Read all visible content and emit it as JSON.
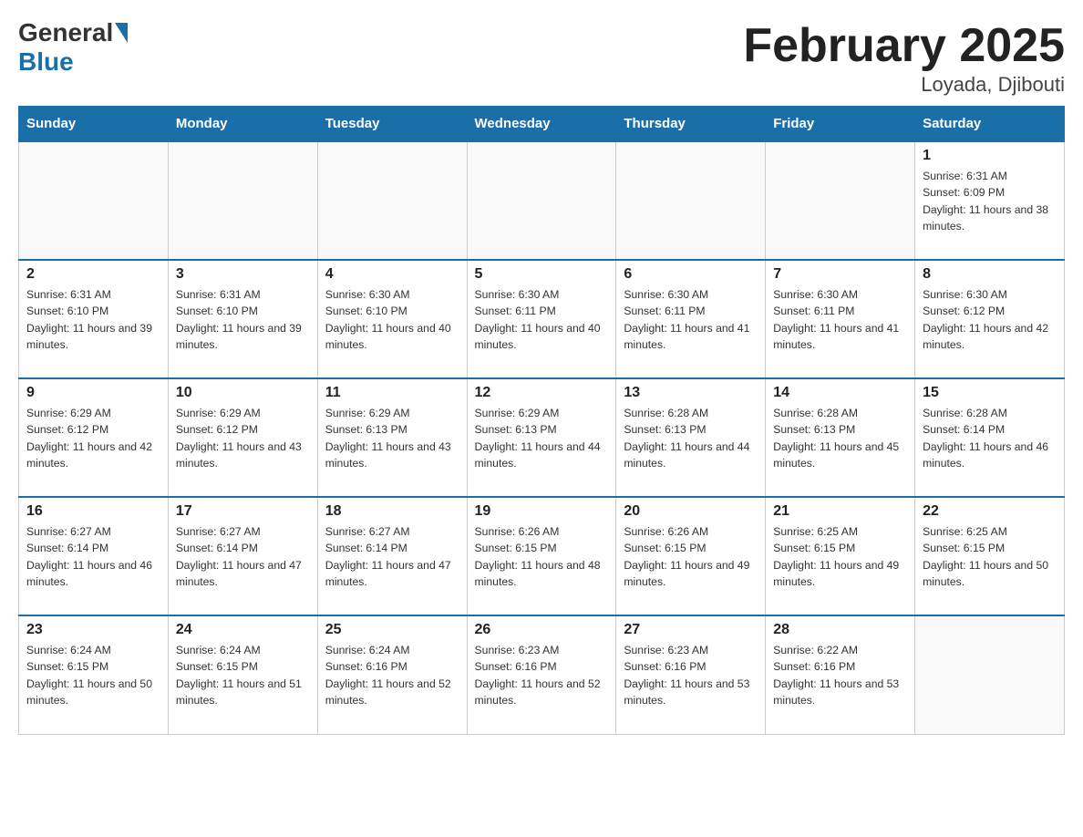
{
  "header": {
    "logo_general": "General",
    "logo_blue": "Blue",
    "month_title": "February 2025",
    "location": "Loyada, Djibouti"
  },
  "days_of_week": [
    "Sunday",
    "Monday",
    "Tuesday",
    "Wednesday",
    "Thursday",
    "Friday",
    "Saturday"
  ],
  "weeks": [
    [
      {
        "day": "",
        "info": ""
      },
      {
        "day": "",
        "info": ""
      },
      {
        "day": "",
        "info": ""
      },
      {
        "day": "",
        "info": ""
      },
      {
        "day": "",
        "info": ""
      },
      {
        "day": "",
        "info": ""
      },
      {
        "day": "1",
        "info": "Sunrise: 6:31 AM\nSunset: 6:09 PM\nDaylight: 11 hours and 38 minutes."
      }
    ],
    [
      {
        "day": "2",
        "info": "Sunrise: 6:31 AM\nSunset: 6:10 PM\nDaylight: 11 hours and 39 minutes."
      },
      {
        "day": "3",
        "info": "Sunrise: 6:31 AM\nSunset: 6:10 PM\nDaylight: 11 hours and 39 minutes."
      },
      {
        "day": "4",
        "info": "Sunrise: 6:30 AM\nSunset: 6:10 PM\nDaylight: 11 hours and 40 minutes."
      },
      {
        "day": "5",
        "info": "Sunrise: 6:30 AM\nSunset: 6:11 PM\nDaylight: 11 hours and 40 minutes."
      },
      {
        "day": "6",
        "info": "Sunrise: 6:30 AM\nSunset: 6:11 PM\nDaylight: 11 hours and 41 minutes."
      },
      {
        "day": "7",
        "info": "Sunrise: 6:30 AM\nSunset: 6:11 PM\nDaylight: 11 hours and 41 minutes."
      },
      {
        "day": "8",
        "info": "Sunrise: 6:30 AM\nSunset: 6:12 PM\nDaylight: 11 hours and 42 minutes."
      }
    ],
    [
      {
        "day": "9",
        "info": "Sunrise: 6:29 AM\nSunset: 6:12 PM\nDaylight: 11 hours and 42 minutes."
      },
      {
        "day": "10",
        "info": "Sunrise: 6:29 AM\nSunset: 6:12 PM\nDaylight: 11 hours and 43 minutes."
      },
      {
        "day": "11",
        "info": "Sunrise: 6:29 AM\nSunset: 6:13 PM\nDaylight: 11 hours and 43 minutes."
      },
      {
        "day": "12",
        "info": "Sunrise: 6:29 AM\nSunset: 6:13 PM\nDaylight: 11 hours and 44 minutes."
      },
      {
        "day": "13",
        "info": "Sunrise: 6:28 AM\nSunset: 6:13 PM\nDaylight: 11 hours and 44 minutes."
      },
      {
        "day": "14",
        "info": "Sunrise: 6:28 AM\nSunset: 6:13 PM\nDaylight: 11 hours and 45 minutes."
      },
      {
        "day": "15",
        "info": "Sunrise: 6:28 AM\nSunset: 6:14 PM\nDaylight: 11 hours and 46 minutes."
      }
    ],
    [
      {
        "day": "16",
        "info": "Sunrise: 6:27 AM\nSunset: 6:14 PM\nDaylight: 11 hours and 46 minutes."
      },
      {
        "day": "17",
        "info": "Sunrise: 6:27 AM\nSunset: 6:14 PM\nDaylight: 11 hours and 47 minutes."
      },
      {
        "day": "18",
        "info": "Sunrise: 6:27 AM\nSunset: 6:14 PM\nDaylight: 11 hours and 47 minutes."
      },
      {
        "day": "19",
        "info": "Sunrise: 6:26 AM\nSunset: 6:15 PM\nDaylight: 11 hours and 48 minutes."
      },
      {
        "day": "20",
        "info": "Sunrise: 6:26 AM\nSunset: 6:15 PM\nDaylight: 11 hours and 49 minutes."
      },
      {
        "day": "21",
        "info": "Sunrise: 6:25 AM\nSunset: 6:15 PM\nDaylight: 11 hours and 49 minutes."
      },
      {
        "day": "22",
        "info": "Sunrise: 6:25 AM\nSunset: 6:15 PM\nDaylight: 11 hours and 50 minutes."
      }
    ],
    [
      {
        "day": "23",
        "info": "Sunrise: 6:24 AM\nSunset: 6:15 PM\nDaylight: 11 hours and 50 minutes."
      },
      {
        "day": "24",
        "info": "Sunrise: 6:24 AM\nSunset: 6:15 PM\nDaylight: 11 hours and 51 minutes."
      },
      {
        "day": "25",
        "info": "Sunrise: 6:24 AM\nSunset: 6:16 PM\nDaylight: 11 hours and 52 minutes."
      },
      {
        "day": "26",
        "info": "Sunrise: 6:23 AM\nSunset: 6:16 PM\nDaylight: 11 hours and 52 minutes."
      },
      {
        "day": "27",
        "info": "Sunrise: 6:23 AM\nSunset: 6:16 PM\nDaylight: 11 hours and 53 minutes."
      },
      {
        "day": "28",
        "info": "Sunrise: 6:22 AM\nSunset: 6:16 PM\nDaylight: 11 hours and 53 minutes."
      },
      {
        "day": "",
        "info": ""
      }
    ]
  ]
}
